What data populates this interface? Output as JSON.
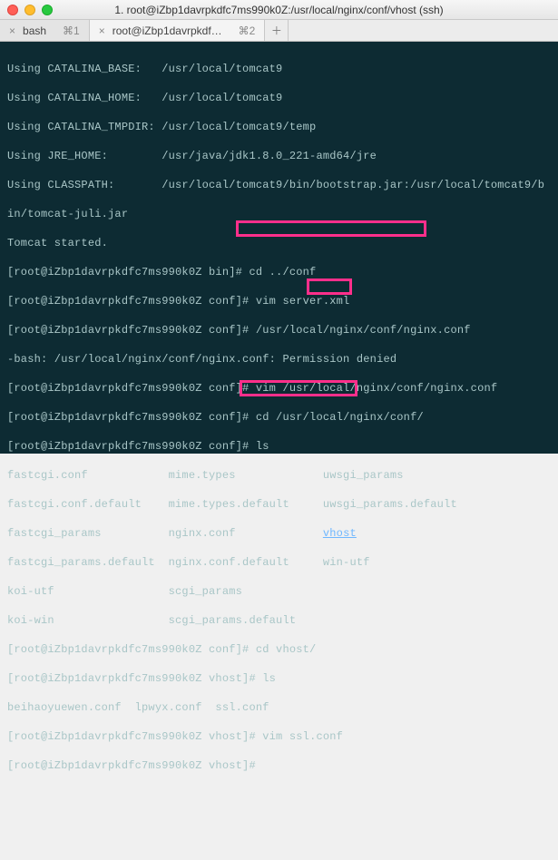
{
  "window": {
    "title": "1. root@iZbp1davrpkdfc7ms990k0Z:/usr/local/nginx/conf/vhost (ssh)"
  },
  "tabs": {
    "tab1_label": "bash",
    "tab1_shortcut": "⌘1",
    "tab2_label": "root@iZbp1davrpkdf…",
    "tab2_shortcut": "⌘2"
  },
  "term": {
    "l01": "Using CATALINA_BASE:   /usr/local/tomcat9",
    "l02": "Using CATALINA_HOME:   /usr/local/tomcat9",
    "l03": "Using CATALINA_TMPDIR: /usr/local/tomcat9/temp",
    "l04": "Using JRE_HOME:        /usr/java/jdk1.8.0_221-amd64/jre",
    "l05": "Using CLASSPATH:       /usr/local/tomcat9/bin/bootstrap.jar:/usr/local/tomcat9/b",
    "l06": "in/tomcat-juli.jar",
    "l07": "Tomcat started.",
    "l08": "[root@iZbp1davrpkdfc7ms990k0Z bin]# cd ../conf",
    "l09": "[root@iZbp1davrpkdfc7ms990k0Z conf]# vim server.xml",
    "l10": "[root@iZbp1davrpkdfc7ms990k0Z conf]# /usr/local/nginx/conf/nginx.conf",
    "l11": "-bash: /usr/local/nginx/conf/nginx.conf: Permission denied",
    "l12": "[root@iZbp1davrpkdfc7ms990k0Z conf]# vim /usr/local/nginx/conf/nginx.conf",
    "l13a": "[root@iZbp1davrpkdfc7ms990k0Z conf]",
    "l13b": "# cd /usr/local/nginx/conf/",
    "l14": "[root@iZbp1davrpkdfc7ms990k0Z conf]# ls",
    "l15a": "fastcgi.conf            mime.types             uwsgi_params",
    "l16a": "fastcgi.conf.default    mime.types.default     uwsgi_params.default",
    "l17a": "fastcgi_params          nginx.conf             ",
    "l17b": "vhost",
    "l18a": "fastcgi_params.default  nginx.conf.default     win-utf",
    "l19a": "koi-utf                 scgi_params",
    "l20a": "koi-win                 scgi_params.default",
    "l21": "[root@iZbp1davrpkdfc7ms990k0Z conf]# cd vhost/",
    "l22": "[root@iZbp1davrpkdfc7ms990k0Z vhost]# ls",
    "l23": "beihaoyuewen.conf  lpwyx.conf  ssl.conf",
    "l24a": "[root@iZbp1davrpkdfc7ms990k0Z vhost]",
    "l24b": "# vim ssl.conf",
    "l25": "[root@iZbp1davrpkdfc7ms990k0Z vhost]# "
  }
}
